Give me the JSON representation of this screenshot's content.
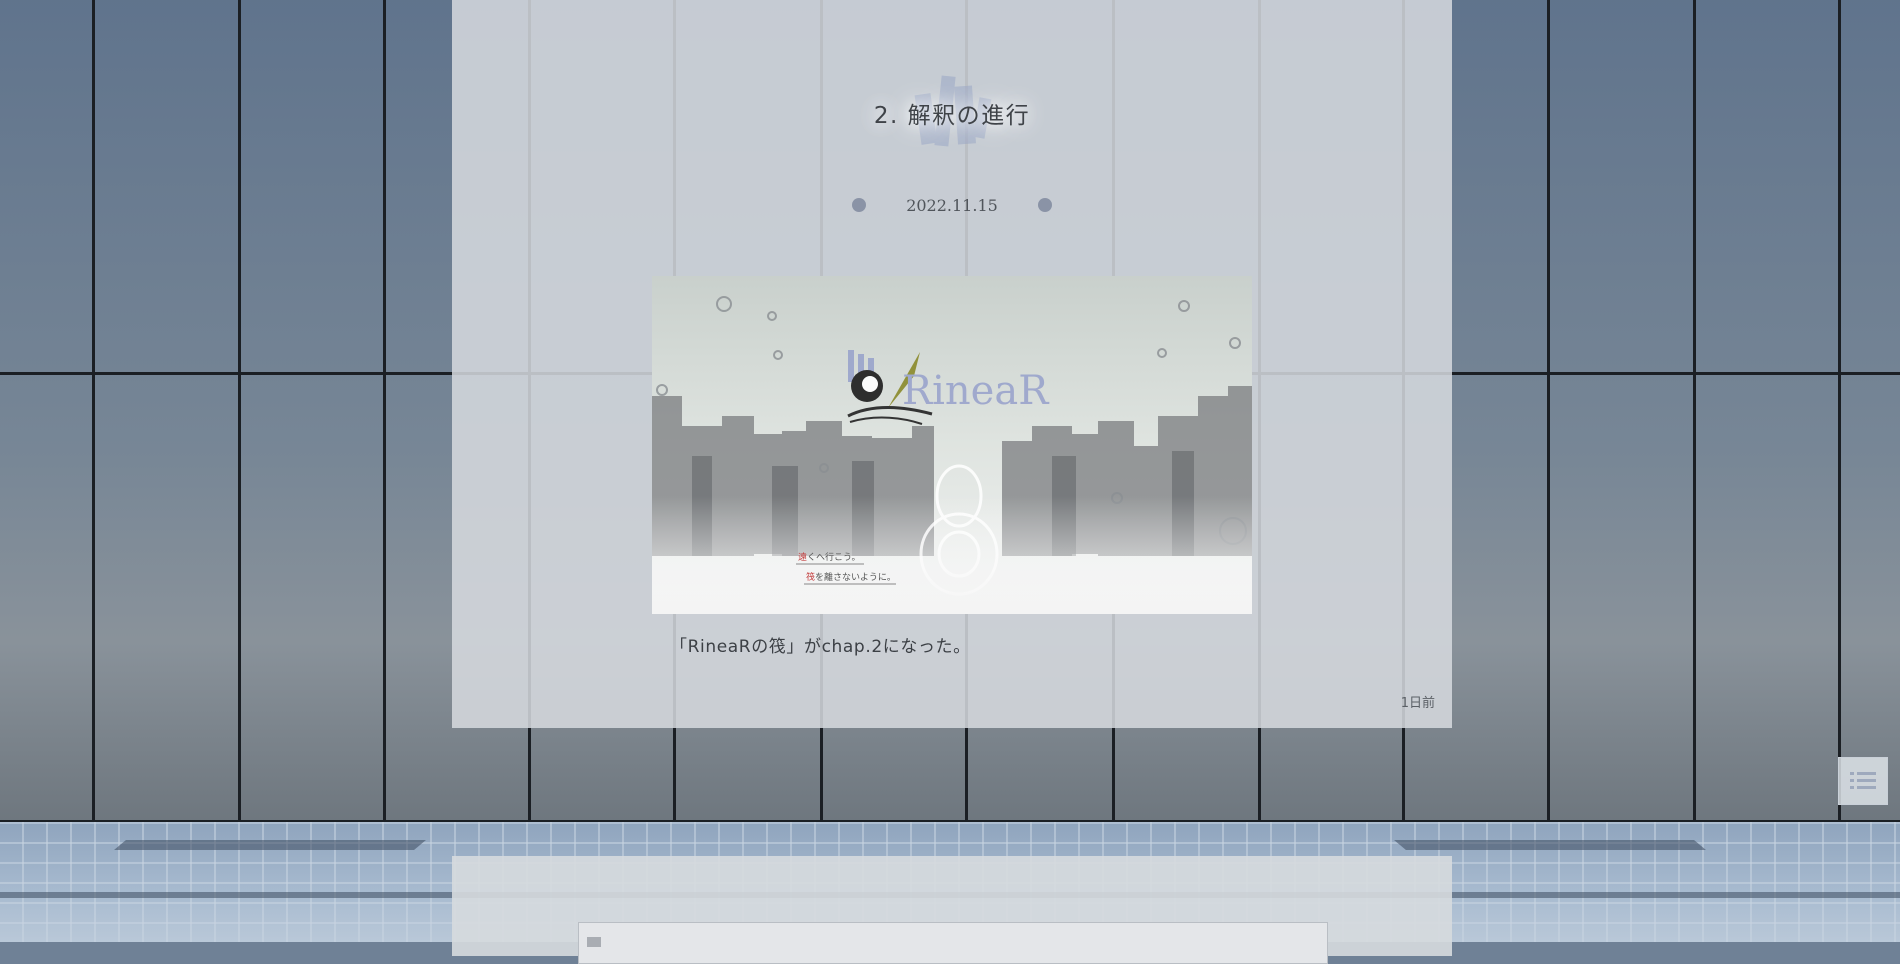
{
  "post": {
    "title": "2. 解釈の進行",
    "date": "2022.11.15",
    "caption": "「RineaRの筏」がchap.2になった。",
    "relative_time": "1日前",
    "image": {
      "logo_text": "RineaR",
      "line1_accent": "遠",
      "line1_rest": "くへ行こう。",
      "line2_accent": "筏",
      "line2_rest": "を離さないように。"
    }
  },
  "toc": {
    "icon": "list-icon"
  }
}
